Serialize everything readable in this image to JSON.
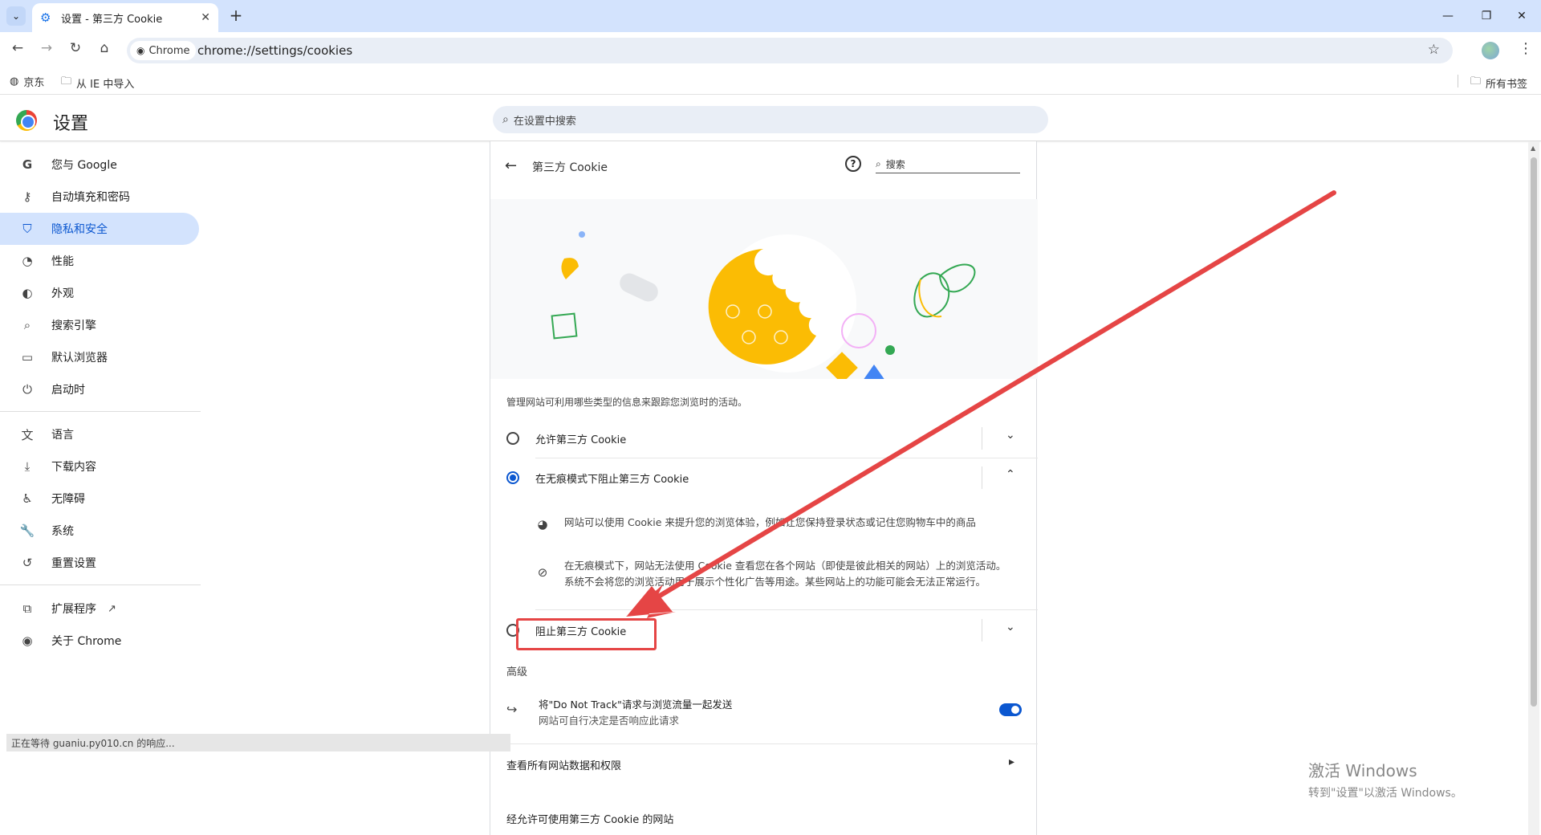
{
  "browser": {
    "tab_title": "设置 - 第三方 Cookie",
    "omnibox_chip": "Chrome",
    "url": "chrome://settings/cookies"
  },
  "bookmarks": {
    "items": [
      {
        "label": "京东"
      },
      {
        "label": "从 IE 中导入"
      }
    ],
    "all_bookmarks": "所有书签"
  },
  "settings": {
    "title": "设置",
    "search_placeholder": "在设置中搜索"
  },
  "sidebar": {
    "items": [
      {
        "label": "您与 Google",
        "icon": "google-icon"
      },
      {
        "label": "自动填充和密码",
        "icon": "key-icon"
      },
      {
        "label": "隐私和安全",
        "icon": "shield-icon"
      },
      {
        "label": "性能",
        "icon": "speedometer-icon"
      },
      {
        "label": "外观",
        "icon": "palette-icon"
      },
      {
        "label": "搜索引擎",
        "icon": "search-icon"
      },
      {
        "label": "默认浏览器",
        "icon": "browser-icon"
      },
      {
        "label": "启动时",
        "icon": "power-icon"
      },
      {
        "label": "语言",
        "icon": "translate-icon"
      },
      {
        "label": "下载内容",
        "icon": "download-icon"
      },
      {
        "label": "无障碍",
        "icon": "accessibility-icon"
      },
      {
        "label": "系统",
        "icon": "wrench-icon"
      },
      {
        "label": "重置设置",
        "icon": "reset-icon"
      },
      {
        "label": "扩展程序",
        "icon": "extension-icon"
      },
      {
        "label": "关于 Chrome",
        "icon": "chrome-icon"
      }
    ]
  },
  "status_bar": "正在等待 guaniu.py010.cn 的响应...",
  "page": {
    "title": "第三方 Cookie",
    "search_placeholder": "搜索",
    "description": "管理网站可利用哪些类型的信息来跟踪您浏览时的活动。",
    "options": [
      {
        "label": "允许第三方 Cookie",
        "selected": false,
        "expanded": false
      },
      {
        "label": "在无痕模式下阻止第三方 Cookie",
        "selected": true,
        "expanded": true
      },
      {
        "label": "阻止第三方 Cookie",
        "selected": false,
        "expanded": false
      }
    ],
    "details": [
      {
        "text": "网站可以使用 Cookie 来提升您的浏览体验，例如让您保持登录状态或记住您购物车中的商品",
        "icon": "cookie-icon"
      },
      {
        "text": "在无痕模式下，网站无法使用 Cookie 查看您在各个网站（即使是彼此相关的网站）上的浏览活动。系统不会将您的浏览活动用于展示个性化广告等用途。某些网站上的功能可能会无法正常运行。",
        "icon": "block-icon"
      }
    ],
    "advanced_title": "高级",
    "dnt": {
      "line1": "将\"Do Not Track\"请求与浏览流量一起发送",
      "line2": "网站可自行决定是否响应此请求",
      "enabled": true
    },
    "site_data_link": "查看所有网站数据和权限",
    "allowed_sites_title": "经允许可使用第三方 Cookie 的网站"
  },
  "watermark": {
    "line1": "激活 Windows",
    "line2": "转到\"设置\"以激活 Windows。"
  },
  "colors": {
    "accent": "#0b57d0",
    "annotation_red": "#e54545",
    "cookie_yellow": "#fbbc04"
  }
}
